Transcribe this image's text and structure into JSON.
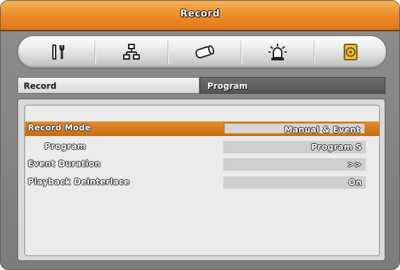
{
  "window": {
    "title": "Record"
  },
  "toolbar": {
    "icons": [
      {
        "name": "tools-icon"
      },
      {
        "name": "network-icon"
      },
      {
        "name": "camera-icon"
      },
      {
        "name": "alarm-icon"
      },
      {
        "name": "record-disk-icon",
        "active": true
      }
    ],
    "accent_color": "#e8841e"
  },
  "tabs": [
    {
      "label": "Record",
      "active": true
    },
    {
      "label": "Program",
      "active": false
    }
  ],
  "settings": [
    {
      "label": "Record Mode",
      "value": "Manual & Event",
      "selected": true
    },
    {
      "label": "Program",
      "value": "Program S",
      "indented": true
    },
    {
      "label": "Event Duration",
      "value": ">>"
    },
    {
      "label": "Playback Deinterlace",
      "value": "On"
    }
  ]
}
